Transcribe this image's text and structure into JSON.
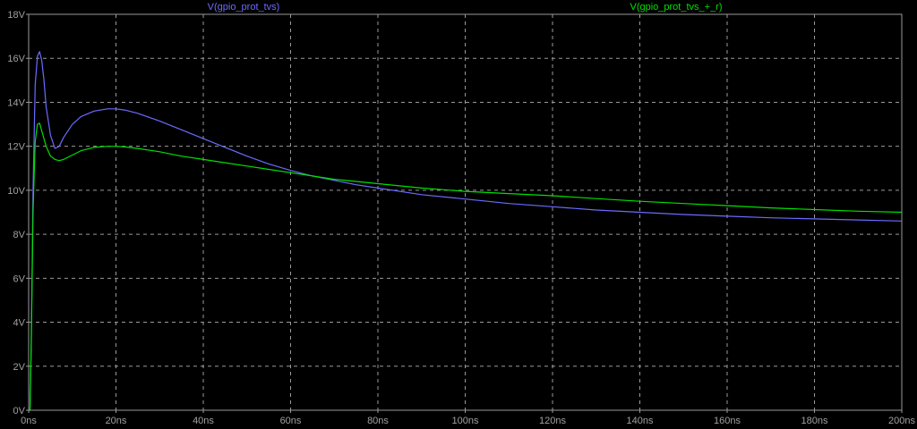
{
  "chart_data": {
    "type": "line",
    "xlabel": "",
    "ylabel": "",
    "xlim": [
      0,
      200
    ],
    "ylim": [
      0,
      18
    ],
    "grid": true,
    "legend_placement": "top",
    "xticks": [
      0,
      20,
      40,
      60,
      80,
      100,
      120,
      140,
      160,
      180,
      200
    ],
    "xtick_labels": [
      "0ns",
      "20ns",
      "40ns",
      "60ns",
      "80ns",
      "100ns",
      "120ns",
      "140ns",
      "160ns",
      "180ns",
      "200ns"
    ],
    "yticks": [
      0,
      2,
      4,
      6,
      8,
      10,
      12,
      14,
      16,
      18
    ],
    "ytick_labels": [
      "0V",
      "2V",
      "4V",
      "6V",
      "8V",
      "10V",
      "12V",
      "14V",
      "16V",
      "18V"
    ],
    "series": [
      {
        "name": "V(gpio_prot_tvs)",
        "color": "#6b6bff",
        "points": [
          [
            0,
            0
          ],
          [
            0.3,
            0
          ],
          [
            0.6,
            3
          ],
          [
            1,
            10
          ],
          [
            1.5,
            14.8
          ],
          [
            2,
            16.1
          ],
          [
            2.5,
            16.3
          ],
          [
            3,
            15.9
          ],
          [
            3.5,
            15.0
          ],
          [
            4,
            13.8
          ],
          [
            5,
            12.5
          ],
          [
            6,
            11.9
          ],
          [
            7,
            12.0
          ],
          [
            8,
            12.4
          ],
          [
            10,
            13.0
          ],
          [
            12,
            13.35
          ],
          [
            15,
            13.6
          ],
          [
            18,
            13.7
          ],
          [
            20,
            13.7
          ],
          [
            22,
            13.65
          ],
          [
            25,
            13.5
          ],
          [
            30,
            13.15
          ],
          [
            35,
            12.75
          ],
          [
            40,
            12.35
          ],
          [
            45,
            11.95
          ],
          [
            50,
            11.55
          ],
          [
            55,
            11.2
          ],
          [
            60,
            10.9
          ],
          [
            65,
            10.65
          ],
          [
            70,
            10.45
          ],
          [
            75,
            10.25
          ],
          [
            80,
            10.1
          ],
          [
            90,
            9.8
          ],
          [
            100,
            9.6
          ],
          [
            110,
            9.4
          ],
          [
            120,
            9.25
          ],
          [
            130,
            9.1
          ],
          [
            140,
            9.0
          ],
          [
            150,
            8.9
          ],
          [
            160,
            8.82
          ],
          [
            170,
            8.75
          ],
          [
            180,
            8.7
          ],
          [
            190,
            8.65
          ],
          [
            200,
            8.6
          ]
        ]
      },
      {
        "name": "V(gpio_prot_tvs_+_r)",
        "color": "#00e000",
        "points": [
          [
            0,
            0
          ],
          [
            0.3,
            0
          ],
          [
            0.6,
            3
          ],
          [
            1,
            9
          ],
          [
            1.5,
            12.2
          ],
          [
            2,
            13.0
          ],
          [
            2.5,
            13.05
          ],
          [
            3,
            12.7
          ],
          [
            4,
            12.0
          ],
          [
            5,
            11.55
          ],
          [
            6,
            11.4
          ],
          [
            7,
            11.35
          ],
          [
            8,
            11.4
          ],
          [
            10,
            11.6
          ],
          [
            12,
            11.8
          ],
          [
            15,
            11.95
          ],
          [
            18,
            12.0
          ],
          [
            20,
            12.0
          ],
          [
            22,
            11.97
          ],
          [
            25,
            11.9
          ],
          [
            30,
            11.75
          ],
          [
            35,
            11.55
          ],
          [
            40,
            11.4
          ],
          [
            45,
            11.25
          ],
          [
            50,
            11.1
          ],
          [
            55,
            10.95
          ],
          [
            60,
            10.8
          ],
          [
            65,
            10.65
          ],
          [
            70,
            10.5
          ],
          [
            75,
            10.4
          ],
          [
            80,
            10.3
          ],
          [
            90,
            10.1
          ],
          [
            100,
            9.95
          ],
          [
            110,
            9.85
          ],
          [
            120,
            9.75
          ],
          [
            130,
            9.62
          ],
          [
            140,
            9.5
          ],
          [
            150,
            9.4
          ],
          [
            160,
            9.3
          ],
          [
            170,
            9.2
          ],
          [
            180,
            9.12
          ],
          [
            190,
            9.05
          ],
          [
            200,
            9.0
          ]
        ]
      }
    ]
  }
}
